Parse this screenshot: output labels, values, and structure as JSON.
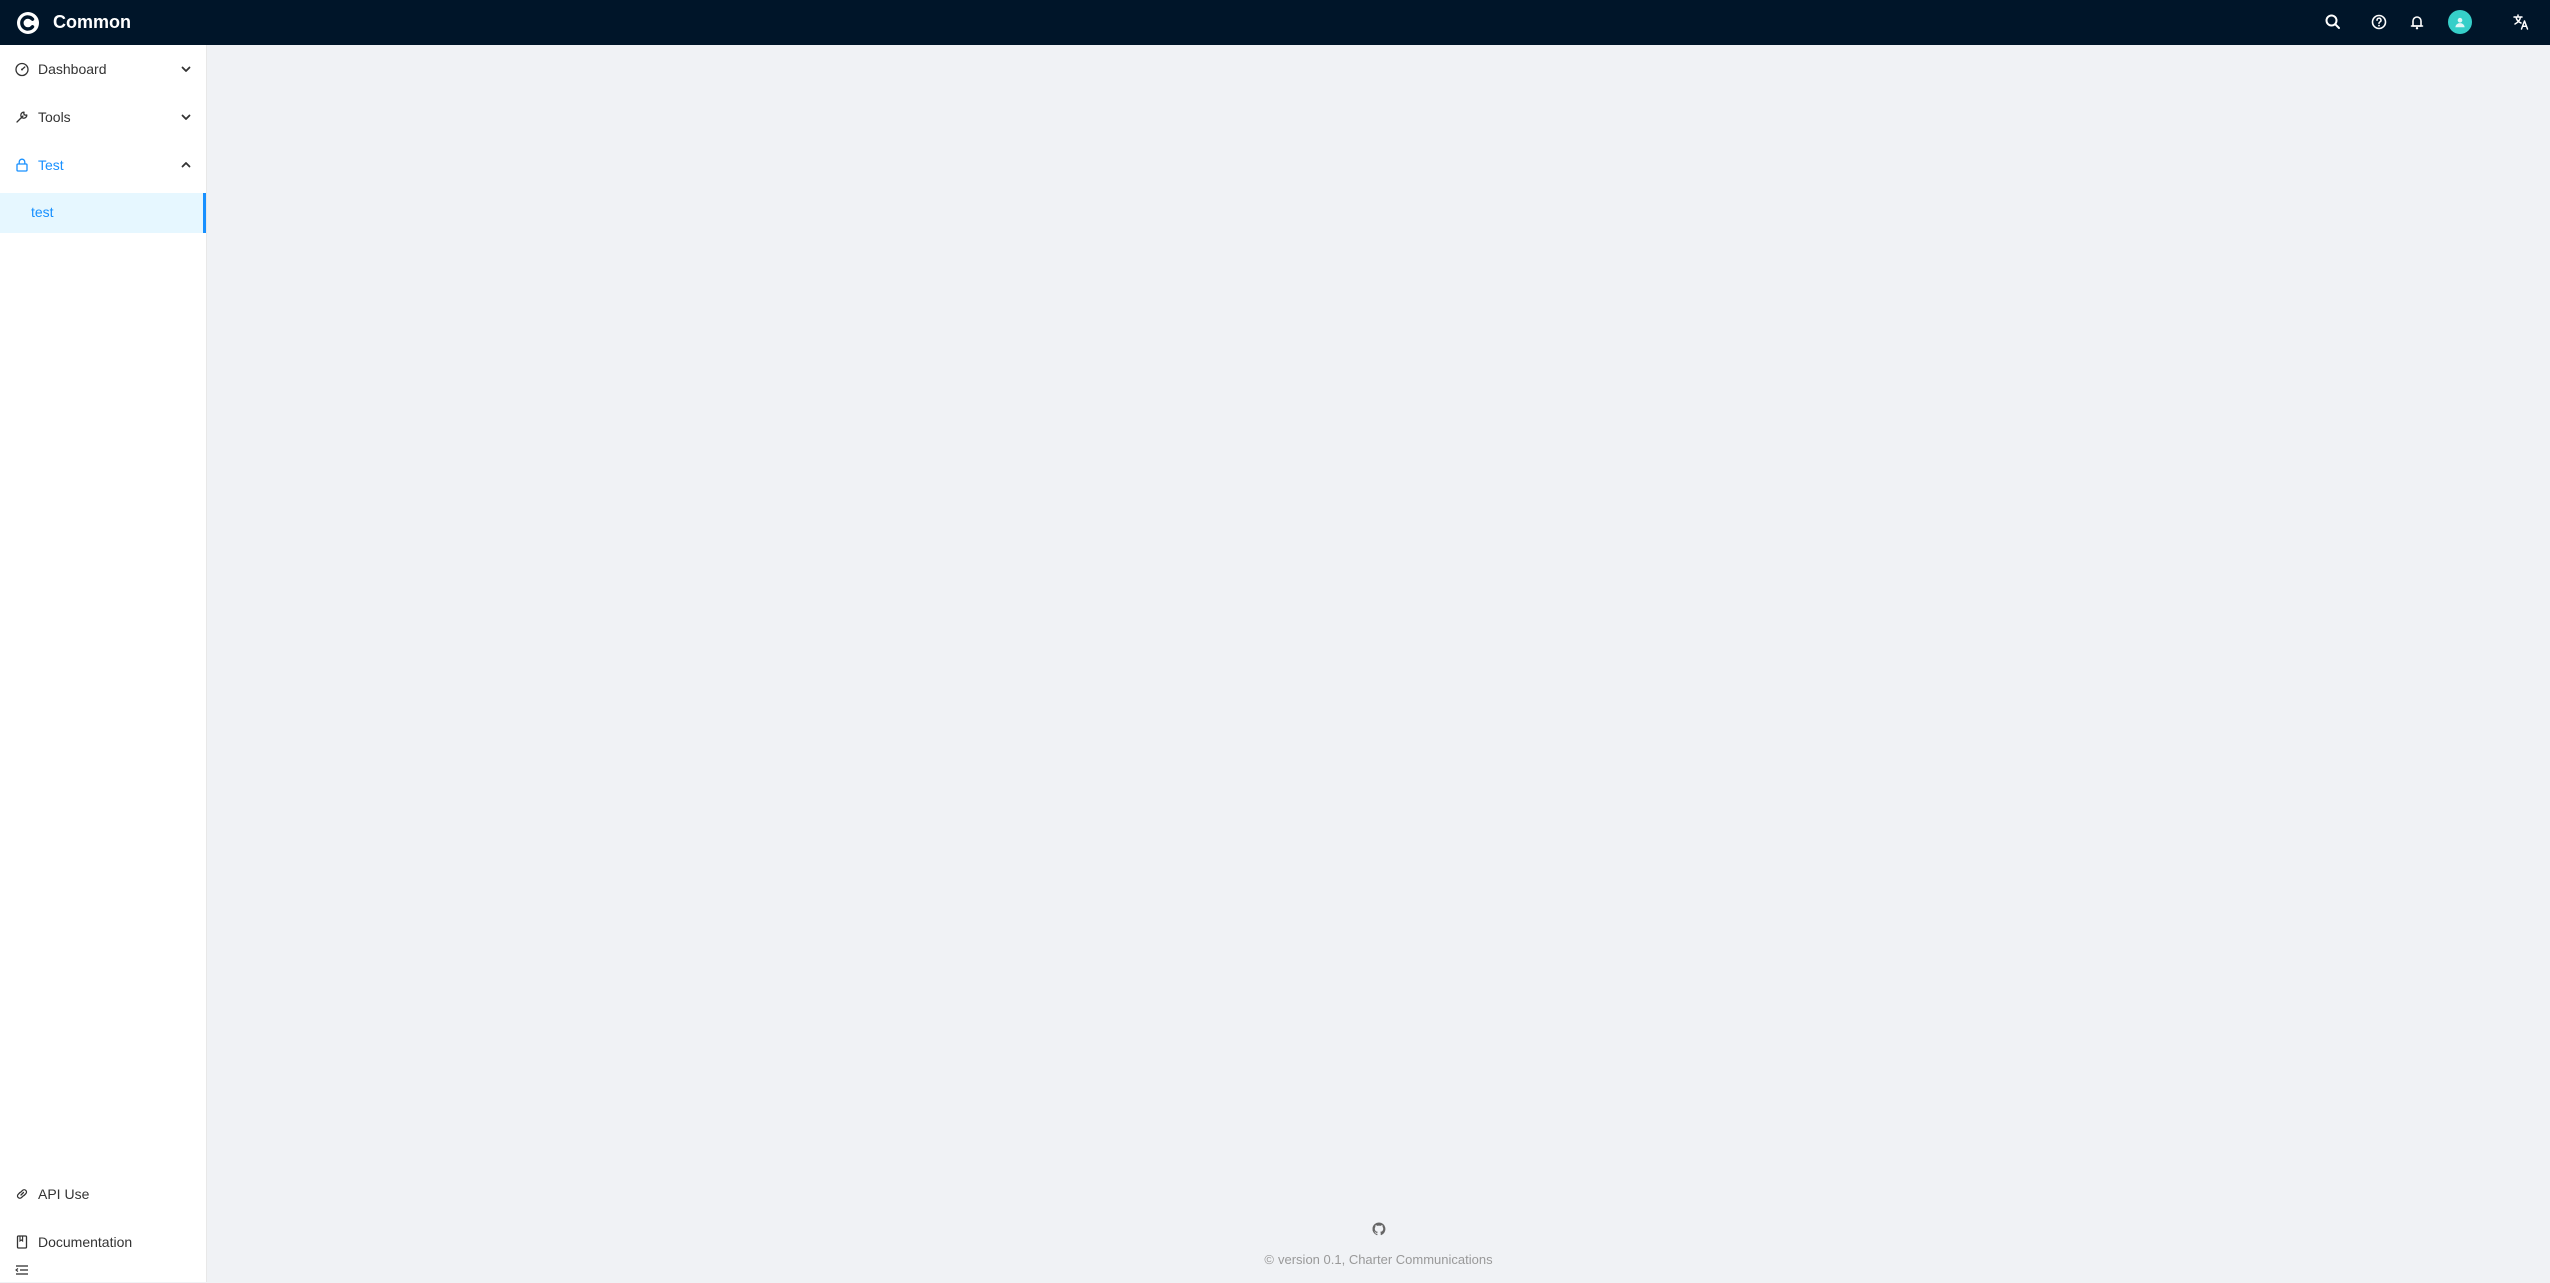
{
  "app": {
    "title": "Common",
    "logo_icon": "common-c-logo"
  },
  "header": {
    "icons": [
      "search-icon",
      "question-circle-icon",
      "bell-icon",
      "user-avatar",
      "translate-icon"
    ],
    "accent": "#36cfc9"
  },
  "sidebar": {
    "items": [
      {
        "label": "Dashboard",
        "icon": "dashboard-icon",
        "expanded": false
      },
      {
        "label": "Tools",
        "icon": "tool-icon",
        "expanded": false
      },
      {
        "label": "Test",
        "icon": "lock-icon",
        "expanded": true,
        "children": [
          {
            "label": "test",
            "selected": true
          }
        ]
      }
    ],
    "bottom_items": [
      {
        "label": "API Use",
        "icon": "link-icon"
      },
      {
        "label": "Documentation",
        "icon": "book-icon"
      }
    ],
    "collapse_icon": "menu-fold-icon"
  },
  "footer": {
    "github_icon": "github-icon",
    "copyright_symbol": "©",
    "text": "version 0.1, Charter Communications"
  },
  "colors": {
    "header_bg": "#001529",
    "accent": "#1890ff",
    "selected_bg": "#e6f7ff",
    "content_bg": "#f0f2f5"
  }
}
